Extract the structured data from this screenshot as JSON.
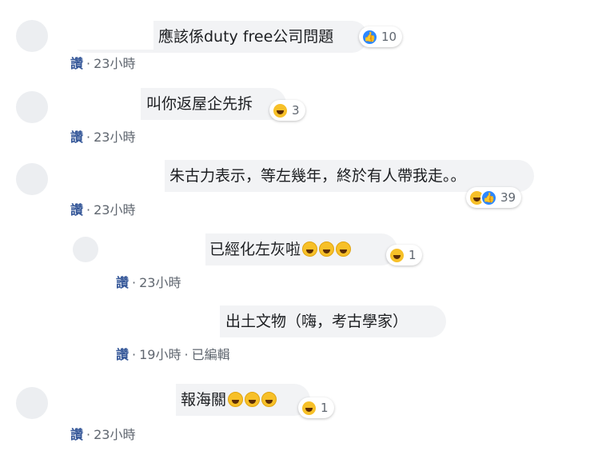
{
  "comments": [
    {
      "text": "應該係duty free公司問題",
      "reaction_count": "10",
      "action": "讚",
      "time": "23小時"
    },
    {
      "text": "叫你返屋企先拆",
      "reaction_count": "3",
      "action": "讚",
      "time": "23小時"
    },
    {
      "text": "朱古力表示，等左幾年，終於有人帶我走。。",
      "reaction_count": "39",
      "action": "讚",
      "time": "23小時"
    },
    {
      "text": "已經化左灰啦",
      "reaction_count": "1",
      "action": "讚",
      "time": "23小時"
    },
    {
      "text": "出土文物（嗨，考古學家）",
      "action": "讚",
      "time": "19小時",
      "edited": "已編輯"
    },
    {
      "text": "報海關",
      "reaction_count": "1",
      "action": "讚",
      "time": "23小時"
    }
  ],
  "icons": {
    "like": "thumbs-up-icon",
    "haha": "laughing-emoji-icon",
    "rofl": "rofl-emoji-icon"
  },
  "colors": {
    "bubble": "#f2f3f5",
    "link": "#365899",
    "meta": "#606770",
    "like": "#2d88ff",
    "haha": "#f7c028"
  }
}
